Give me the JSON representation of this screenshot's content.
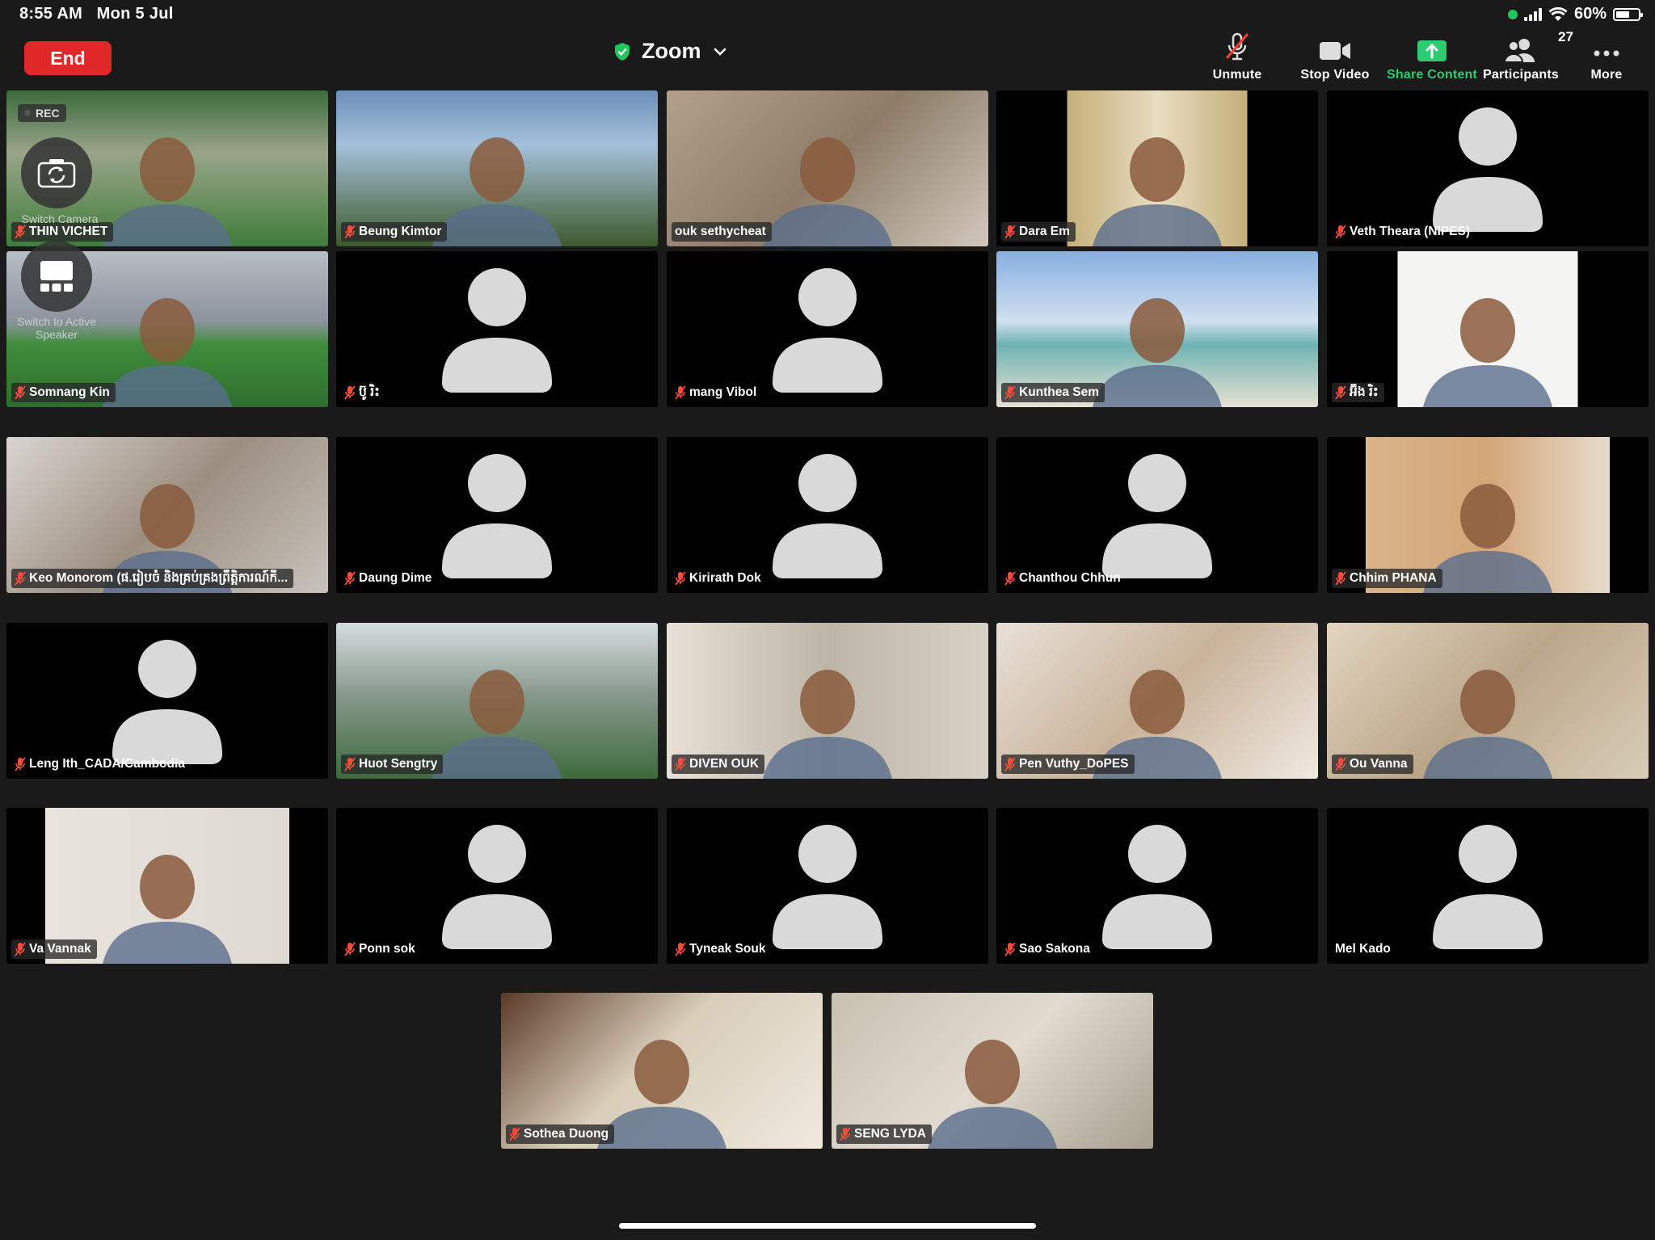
{
  "status_bar": {
    "time": "8:55 AM",
    "date": "Mon 5 Jul",
    "battery": "60%",
    "battery_level": 0.6
  },
  "meeting": {
    "end_label": "End",
    "app_title": "Zoom"
  },
  "toolbar": {
    "unmute_label": "Unmute",
    "stop_video_label": "Stop Video",
    "share_label": "Share Content",
    "participants_label": "Participants",
    "participants_count": "27",
    "more_label": "More"
  },
  "overlays": {
    "rec_label": "REC",
    "switch_camera_label": "Switch Camera",
    "switch_speaker_label": "Switch to Active Speaker"
  },
  "colors": {
    "end_button": "#e02828",
    "share_accent": "#2ecc71",
    "active_speaker_border": "#31c35a",
    "background": "#1a1a1a"
  },
  "participants": [
    {
      "name": "THIN VICHET",
      "muted": true,
      "video": true
    },
    {
      "name": "Beung Kimtor",
      "muted": true,
      "video": true
    },
    {
      "name": "ouk sethycheat",
      "muted": false,
      "video": true
    },
    {
      "name": "Dara Em",
      "muted": true,
      "video": true
    },
    {
      "name": "Veth Theara (NIPES)",
      "muted": true,
      "video": false
    },
    {
      "name": "Somnang Kin",
      "muted": true,
      "video": true
    },
    {
      "name": "ប៊ូ រិះ",
      "muted": true,
      "video": false
    },
    {
      "name": "mang Vibol",
      "muted": true,
      "video": false
    },
    {
      "name": "Kunthea Sem",
      "muted": true,
      "video": true
    },
    {
      "name": "អ៊ឹង រិះ",
      "muted": true,
      "video": true
    },
    {
      "name": "Keo Monorom (ផ.រៀបចំ និងគ្រប់គ្រងព្រឹត្តិការណ៍កី...",
      "muted": true,
      "video": true
    },
    {
      "name": "Daung Dime",
      "muted": true,
      "video": false
    },
    {
      "name": "Kirirath Dok",
      "muted": true,
      "video": false
    },
    {
      "name": "Chanthou Chhun",
      "muted": true,
      "video": false
    },
    {
      "name": "Chhim PHANA",
      "muted": true,
      "video": true
    },
    {
      "name": "Leng Ith_CADA/Cambodia",
      "muted": true,
      "video": false
    },
    {
      "name": "Huot Sengtry",
      "muted": true,
      "video": true
    },
    {
      "name": "DIVEN OUK",
      "muted": true,
      "video": true
    },
    {
      "name": "Pen Vuthy_DoPES",
      "muted": true,
      "video": true
    },
    {
      "name": "Ou Vanna",
      "muted": true,
      "video": true
    },
    {
      "name": "Va Vannak",
      "muted": true,
      "video": true
    },
    {
      "name": "Ponn sok",
      "muted": true,
      "video": false
    },
    {
      "name": "Tyneak Souk",
      "muted": true,
      "video": false
    },
    {
      "name": "Sao Sakona",
      "muted": true,
      "video": false
    },
    {
      "name": "Mel Kado",
      "muted": false,
      "video": false
    },
    {
      "name": "Sothea Duong",
      "muted": true,
      "video": true
    },
    {
      "name": "SENG LYDA",
      "muted": true,
      "video": true
    }
  ]
}
